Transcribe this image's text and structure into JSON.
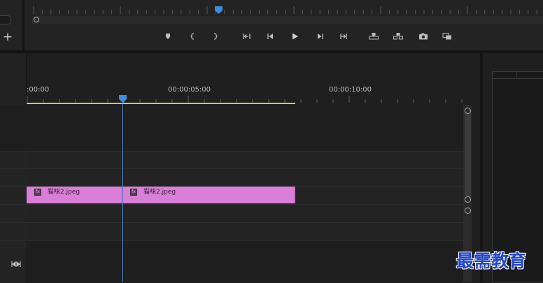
{
  "header": {
    "add_label": "+"
  },
  "monitor": {
    "controls": [
      {
        "name": "add-marker-button",
        "icon": "marker-icon"
      },
      {
        "name": "mark-in-button",
        "icon": "mark-in-icon"
      },
      {
        "name": "mark-out-button",
        "icon": "mark-out-icon"
      },
      {
        "name": "go-to-in-button",
        "icon": "go-to-in-icon"
      },
      {
        "name": "step-back-button",
        "icon": "step-back-icon"
      },
      {
        "name": "play-button",
        "icon": "play-icon"
      },
      {
        "name": "step-forward-button",
        "icon": "step-forward-icon"
      },
      {
        "name": "go-to-out-button",
        "icon": "go-to-out-icon"
      },
      {
        "name": "lift-button",
        "icon": "lift-icon"
      },
      {
        "name": "extract-button",
        "icon": "extract-icon"
      },
      {
        "name": "export-frame-button",
        "icon": "camera-icon"
      },
      {
        "name": "comparison-view-button",
        "icon": "comparison-view-icon"
      }
    ]
  },
  "timeline": {
    "timecodes": [
      ":00:00",
      "00:00:05:00",
      "00:00:10:00"
    ],
    "clips": [
      {
        "name": "猫咪2.jpeg",
        "fx": "fx"
      },
      {
        "name": "猫咪2.jpeg",
        "fx": "fx"
      }
    ],
    "collapse_icon": "collapse-tracks-icon"
  },
  "colors": {
    "accent": "#4b93dd",
    "clip": "#d97fd8",
    "work_area": "#d9d21d"
  },
  "watermark": "最需教育"
}
